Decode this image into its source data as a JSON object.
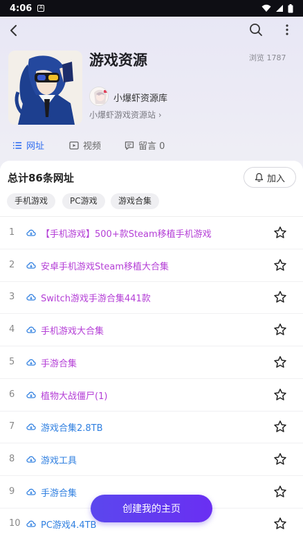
{
  "statusbar": {
    "time": "4:06"
  },
  "header": {
    "title": "游戏资源",
    "views": "浏览 1787",
    "author_name": "小爆虾资源库",
    "author_site": "小爆虾游戏资源站 ›"
  },
  "tabs": [
    {
      "label": "网址",
      "icon": "list-icon",
      "active": true
    },
    {
      "label": "视频",
      "icon": "video-icon",
      "active": false
    },
    {
      "label": "留言 0",
      "icon": "comment-icon",
      "active": false
    }
  ],
  "list_header": {
    "total": "总计86条网址",
    "join_label": "加入"
  },
  "chips": [
    "手机游戏",
    "PC游戏",
    "游戏合集"
  ],
  "rows": [
    {
      "num": "1",
      "title": "【手机游戏】500+款Steam移植手机游戏",
      "color": "#b43ed6"
    },
    {
      "num": "2",
      "title": "安卓手机游戏Steam移植大合集",
      "color": "#b43ed6"
    },
    {
      "num": "3",
      "title": "Switch游戏手游合集441款",
      "color": "#b43ed6"
    },
    {
      "num": "4",
      "title": "手机游戏大合集",
      "color": "#b43ed6"
    },
    {
      "num": "5",
      "title": "手游合集",
      "color": "#b43ed6"
    },
    {
      "num": "6",
      "title": "植物大战僵尸(1)",
      "color": "#b43ed6"
    },
    {
      "num": "7",
      "title": "游戏合集2.8TB",
      "color": "#2f7fe0"
    },
    {
      "num": "8",
      "title": "游戏工具",
      "color": "#2f7fe0"
    },
    {
      "num": "9",
      "title": "手游合集",
      "color": "#2f7fe0"
    },
    {
      "num": "10",
      "title": "PC游戏4.4TB",
      "color": "#2f7fe0"
    }
  ],
  "fab_label": "创建我的主页",
  "colors": {
    "accent": "#2f6df0",
    "fab": "#5b47ee",
    "purple_link": "#b43ed6",
    "blue_link": "#2f7fe0"
  }
}
